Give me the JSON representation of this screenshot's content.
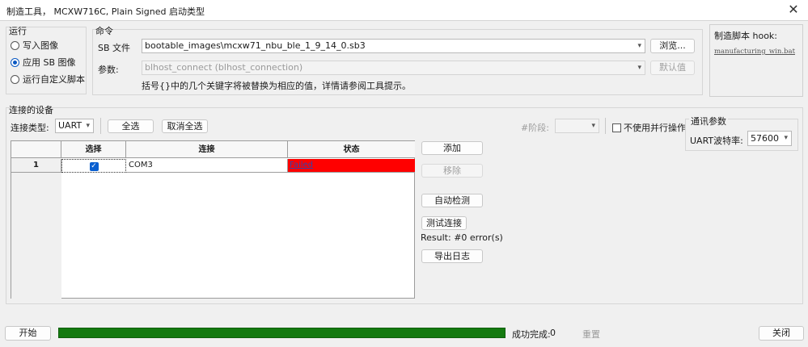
{
  "window": {
    "title": "制造工具， MCXW716C, Plain Signed 启动类型",
    "close_glyph": "✕"
  },
  "run_group": {
    "title": "运行",
    "options": [
      {
        "label": "写入图像",
        "checked": false
      },
      {
        "label": "应用 SB 图像",
        "checked": true
      },
      {
        "label": "运行自定义脚本",
        "checked": false
      }
    ]
  },
  "command_group": {
    "title": "命令",
    "sb_file_label": "SB 文件",
    "sb_file_value": "bootable_images\\mcxw71_nbu_ble_1_9_14_0.sb3",
    "browse_label": "浏览...",
    "params_label": "参数:",
    "params_value": "blhost_connect (blhost_connection)",
    "default_label": "默认值",
    "hint": "括号{}中的几个关键字将被替换为相应的值，详情请参阅工具提示。"
  },
  "hook_group": {
    "title": "制造脚本 hook:",
    "file": "manufacturing_win.bat"
  },
  "devices_group": {
    "title": "连接的设备",
    "conn_type_label": "连接类型:",
    "conn_type_value": "UART",
    "select_all_label": "全选",
    "deselect_all_label": "取消全选",
    "stage_label": "#阶段:",
    "no_parallel_label": "不使用并行操作",
    "table": {
      "headers": [
        "选择",
        "连接",
        "状态"
      ],
      "rows": [
        {
          "index": "1",
          "selected": true,
          "connection": "COM3",
          "status": "Failed"
        }
      ]
    },
    "add_label": "添加",
    "remove_label": "移除",
    "auto_detect_label": "自动检测",
    "test_conn_label": "测试连接",
    "result_text": "Result: #0 error(s)",
    "export_log_label": "导出日志"
  },
  "comm_group": {
    "title": "通讯参数",
    "baud_label": "UART波特率:",
    "baud_value": "57600"
  },
  "bottom": {
    "start_label": "开始",
    "progress": 1.0,
    "success_label": "成功完成:",
    "success_count": "0",
    "reset_label": "重置",
    "close_label": "关闭"
  },
  "colors": {
    "progress": "#147a10",
    "failed_bg": "#ff0000",
    "checkbox_blue": "#0a5fd0"
  }
}
